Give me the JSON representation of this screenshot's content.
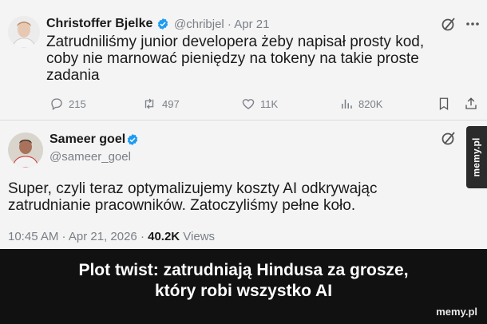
{
  "tweet1": {
    "author_name": "Christoffer Bjelke",
    "handle_date": "@chribjel · Apr 21",
    "text_lines": [
      "Zatrudniliśmy junior developera żeby napisał prosty kod,",
      "coby nie marnować pieniędzy na tokeny na takie proste",
      "zadania"
    ],
    "replies": "215",
    "reposts": "497",
    "likes": "11K",
    "views": "820K"
  },
  "tweet2": {
    "author_name": "Sameer goel",
    "handle": "@sameer_goel",
    "text_lines": [
      "Super, czyli teraz optymalizujemy koszty AI odkrywając",
      "zatrudnianie pracowników. Zatoczyliśmy pełne koło."
    ],
    "time_date": "10:45 AM · Apr 21, 2026 · ",
    "views_count": "40.2K",
    "views_label": " Views"
  },
  "sidetab": "memy.pl",
  "caption_lines": [
    "Plot twist: zatrudniają Hindusa za grosze,",
    "który robi wszystko AI"
  ],
  "watermark": "memy.pl",
  "colors": {
    "verified": "#1d9bf0",
    "caption_bg": "#111111",
    "muted": "#7a7f86"
  },
  "icons": [
    "grok-icon",
    "verified-badge-icon",
    "reply-icon",
    "repost-icon",
    "like-icon",
    "views-icon",
    "bookmark-icon",
    "share-icon"
  ]
}
